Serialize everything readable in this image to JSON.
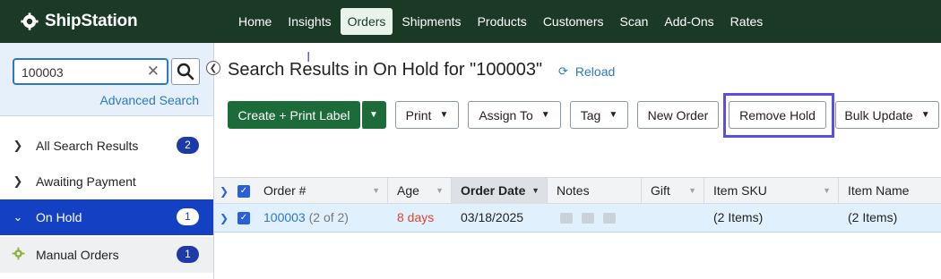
{
  "app": {
    "logo_text": "ShipStation"
  },
  "nav": {
    "items": [
      {
        "label": "Home"
      },
      {
        "label": "Insights"
      },
      {
        "label": "Orders",
        "active": true
      },
      {
        "label": "Shipments"
      },
      {
        "label": "Products"
      },
      {
        "label": "Customers"
      },
      {
        "label": "Scan"
      },
      {
        "label": "Add-Ons"
      },
      {
        "label": "Rates"
      }
    ]
  },
  "sidebar": {
    "search": {
      "value": "100003",
      "clear_icon": "close-icon",
      "button_icon": "search-icon"
    },
    "advanced_search": "Advanced Search",
    "items": [
      {
        "label": "All Search Results",
        "count": "2",
        "icon": "chevron-right-icon"
      },
      {
        "label": "Awaiting Payment",
        "count": "",
        "icon": "chevron-right-icon"
      },
      {
        "label": "On Hold",
        "count": "1",
        "icon": "chevron-down-icon",
        "active": true
      },
      {
        "label": "Manual Orders",
        "count": "1",
        "icon": "gear-icon"
      }
    ]
  },
  "main": {
    "title": "Search Results in On Hold for \"100003\"",
    "reload": "Reload",
    "toolbar": {
      "create_print": "Create + Print Label",
      "print": "Print",
      "assign_to": "Assign To",
      "tag": "Tag",
      "new_order": "New Order",
      "remove_hold": "Remove Hold",
      "bulk_update": "Bulk Update"
    },
    "table": {
      "columns": [
        "Order #",
        "Age",
        "Order Date",
        "Notes",
        "Gift",
        "Item SKU",
        "Item Name"
      ],
      "sorted_column": "Order Date",
      "rows": [
        {
          "order_number": "100003",
          "order_suffix": "(2 of 2)",
          "age": "8 days",
          "order_date": "03/18/2025",
          "notes": "",
          "gift": "",
          "item_sku": "(2 Items)",
          "item_name": "(2 Items)"
        }
      ]
    }
  },
  "colors": {
    "topbar": "#1b3a26",
    "primary_button": "#1e6b3a",
    "active_sidebar": "#1441c4",
    "link": "#2b78c5",
    "highlight": "#5b4ee6",
    "age_text": "#d9462f"
  }
}
